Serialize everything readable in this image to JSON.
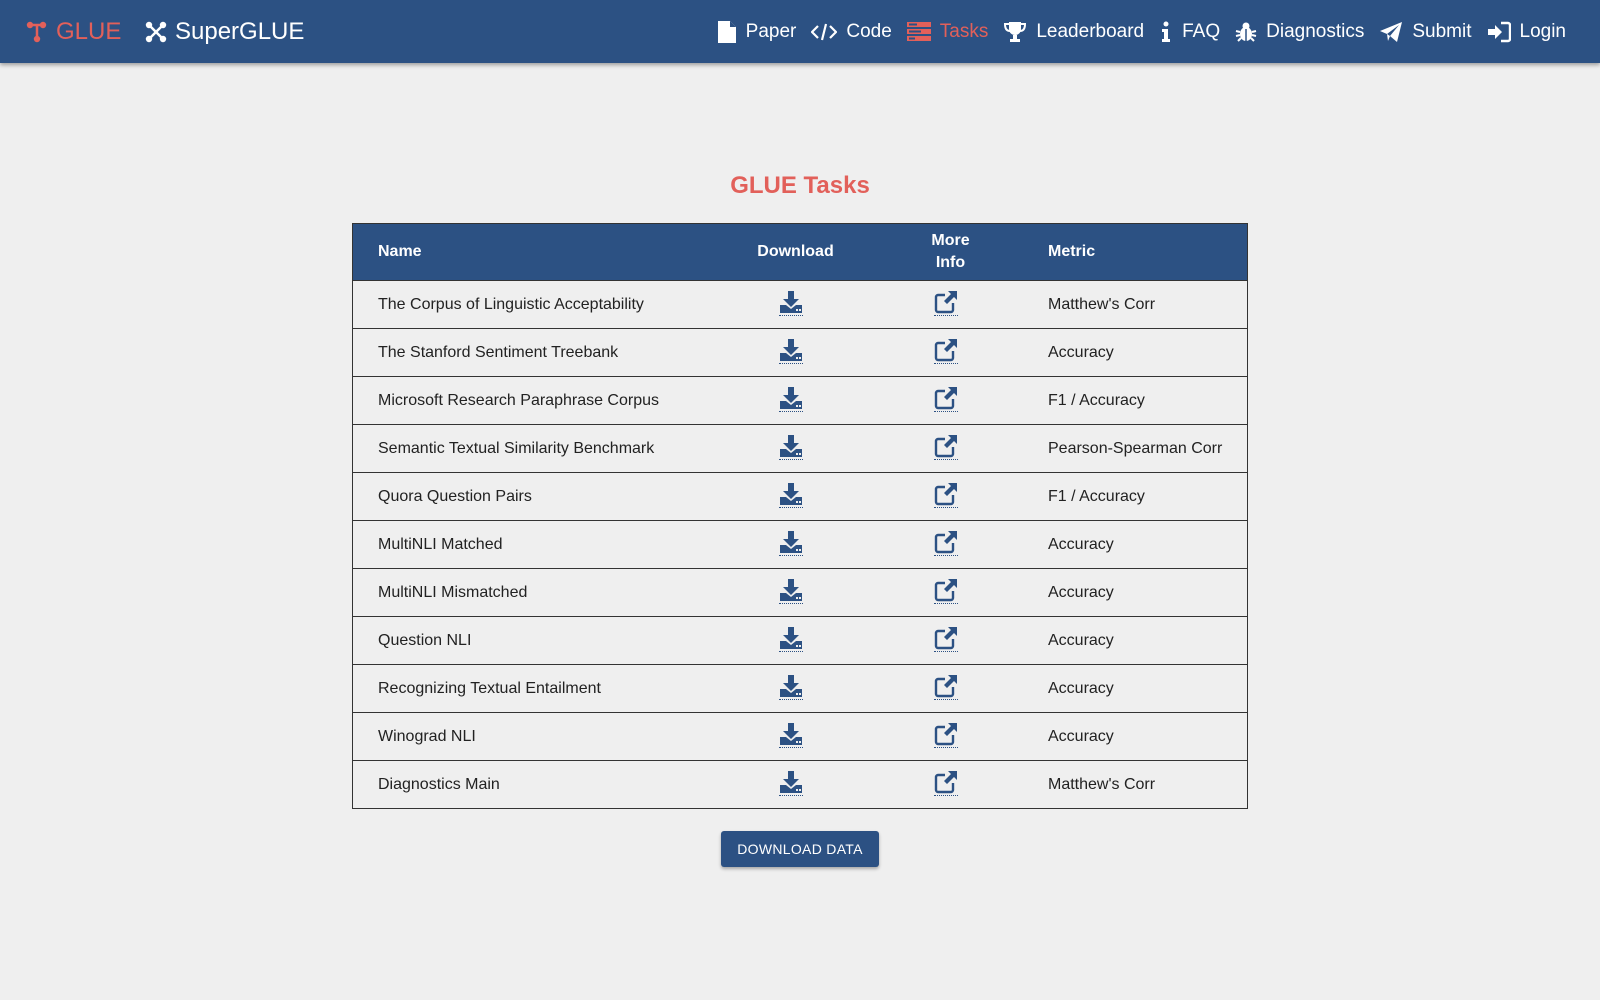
{
  "brand": {
    "glue": "GLUE",
    "superglue": "SuperGLUE"
  },
  "nav": [
    {
      "label": "Paper",
      "icon": "file-icon"
    },
    {
      "label": "Code",
      "icon": "code-icon"
    },
    {
      "label": "Tasks",
      "icon": "tasks-icon",
      "active": true
    },
    {
      "label": "Leaderboard",
      "icon": "trophy-icon"
    },
    {
      "label": "FAQ",
      "icon": "info-icon"
    },
    {
      "label": "Diagnostics",
      "icon": "bug-icon"
    },
    {
      "label": "Submit",
      "icon": "send-icon"
    },
    {
      "label": "Login",
      "icon": "login-icon"
    }
  ],
  "page": {
    "title": "GLUE Tasks"
  },
  "table": {
    "headers": {
      "name": "Name",
      "download": "Download",
      "more_info_line1": "More",
      "more_info_line2": "Info",
      "metric": "Metric"
    },
    "rows": [
      {
        "name": "The Corpus of Linguistic Acceptability",
        "metric": "Matthew's Corr"
      },
      {
        "name": "The Stanford Sentiment Treebank",
        "metric": "Accuracy"
      },
      {
        "name": "Microsoft Research Paraphrase Corpus",
        "metric": "F1 / Accuracy"
      },
      {
        "name": "Semantic Textual Similarity Benchmark",
        "metric": "Pearson-Spearman Corr"
      },
      {
        "name": "Quora Question Pairs",
        "metric": "F1 / Accuracy"
      },
      {
        "name": "MultiNLI Matched",
        "metric": "Accuracy"
      },
      {
        "name": "MultiNLI Mismatched",
        "metric": "Accuracy"
      },
      {
        "name": "Question NLI",
        "metric": "Accuracy"
      },
      {
        "name": "Recognizing Textual Entailment",
        "metric": "Accuracy"
      },
      {
        "name": "Winograd NLI",
        "metric": "Accuracy"
      },
      {
        "name": "Diagnostics Main",
        "metric": "Matthew's Corr"
      }
    ]
  },
  "download_button": "DOWNLOAD DATA",
  "colors": {
    "primary": "#2c5183",
    "accent": "#e2605a",
    "background": "#efefef"
  }
}
